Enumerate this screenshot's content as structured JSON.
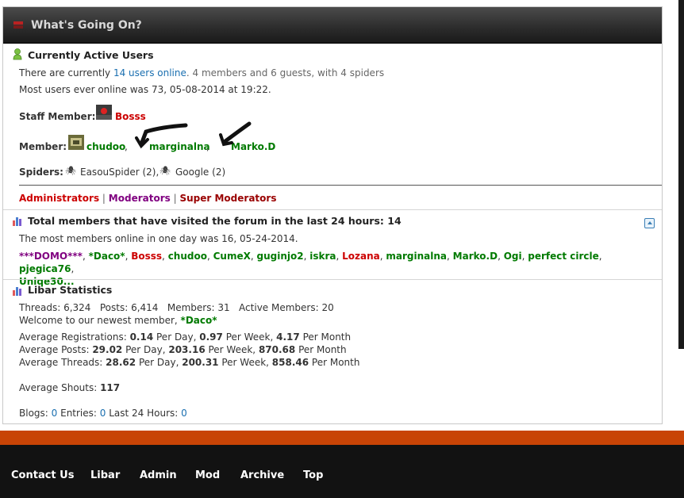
{
  "header": {
    "title": "What's Going On?"
  },
  "active_users": {
    "title": "Currently Active Users",
    "line1_prefix": "There are currently ",
    "line1_link": "14 users online",
    "line1_suffix": ". 4 members and 6 guests, with 4 spiders",
    "line2": "Most users ever online was 73, 05-08-2014 at 19:22.",
    "staff_label": "Staff Member:",
    "staff_avatar_text": "Bosss",
    "staff_name": "Bosss",
    "member_label": "Member:",
    "members": [
      "chudoo",
      "marginalna",
      "Marko.D"
    ],
    "comma": ",",
    "spiders_label": "Spiders:",
    "spiders": [
      "EasouSpider (2),",
      "Google (2)"
    ],
    "legend": [
      "Administrators",
      "Moderators",
      "Super Moderators"
    ],
    "legend_sep": "|"
  },
  "visited": {
    "title": "Total members that have visited the forum in the last 24 hours: 14",
    "line1": "The most members online in one day was 16, 05-24-2014.",
    "names": [
      {
        "name": "***DOMO***",
        "color": "purple"
      },
      {
        "name": "*Daco*",
        "color": "green"
      },
      {
        "name": "Bosss",
        "color": "red"
      },
      {
        "name": "chudoo",
        "color": "green"
      },
      {
        "name": "CumeX",
        "color": "green"
      },
      {
        "name": "guginjo2",
        "color": "green"
      },
      {
        "name": "iskra",
        "color": "green"
      },
      {
        "name": "Lozana",
        "color": "red"
      },
      {
        "name": "marginalna",
        "color": "green"
      },
      {
        "name": "Marko.D",
        "color": "green"
      },
      {
        "name": "Ogi",
        "color": "green"
      },
      {
        "name": "perfect circle",
        "color": "green"
      },
      {
        "name": "pjegica76",
        "color": "green"
      }
    ],
    "last_name": "Uniqe30..."
  },
  "stats": {
    "title": "Libar Statistics",
    "line1": "Threads: 6,324   Posts: 6,414   Members: 31   Active Members: 20",
    "welcome_prefix": "Welcome to our newest member, ",
    "newest_member": "*Daco*",
    "reg_label": "Average Registrations: ",
    "reg_day": "0.14",
    "reg_week": "0.97",
    "reg_month": "4.17",
    "posts_label": "Average Posts: ",
    "posts_day": "29.02",
    "posts_week": "203.16",
    "posts_month": "870.68",
    "threads_label": "Average Threads: ",
    "threads_day": "28.62",
    "threads_week": "200.31",
    "threads_month": "858.46",
    "per_day": " Per Day, ",
    "per_week": " Per Week, ",
    "per_month": " Per Month",
    "shouts_label": "Average Shouts: ",
    "shouts_value": "117",
    "blogs_label": "Blogs: ",
    "blogs_value": "0",
    "entries_label": "Entries: ",
    "entries_value": "0",
    "last24_label": "Last 24 Hours: ",
    "last24_value": "0"
  },
  "footer": {
    "links": [
      "Contact Us",
      "Libar",
      "Admin",
      "Mod",
      "Archive",
      "Top"
    ]
  },
  "colors": {
    "accent_orange": "#c84406",
    "header_dark": "#2b2b2b",
    "member_green": "#007a00",
    "admin_red": "#cc0000",
    "mod_purple": "#800080"
  }
}
